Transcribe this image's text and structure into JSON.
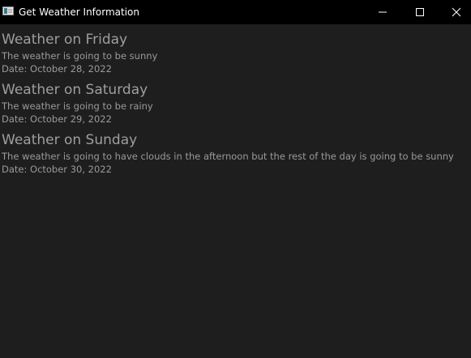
{
  "window": {
    "title": "Get Weather Information",
    "icon": "app-window-icon",
    "controls": {
      "minimize_icon": "minimize-icon",
      "maximize_icon": "maximize-icon",
      "close_icon": "close-icon"
    }
  },
  "days": [
    {
      "heading": "Weather on Friday",
      "description": "The weather is going to be sunny",
      "date": "Date: October 28, 2022"
    },
    {
      "heading": "Weather on Saturday",
      "description": "The weather is going to be rainy",
      "date": "Date: October 29, 2022"
    },
    {
      "heading": "Weather on Sunday",
      "description": "The weather is going to have clouds in the afternoon but the rest of the day is going to be sunny",
      "date": "Date: October 30, 2022"
    }
  ],
  "colors": {
    "background": "#1e1e1e",
    "titlebar": "#000000",
    "text": "#9a9a9a"
  }
}
